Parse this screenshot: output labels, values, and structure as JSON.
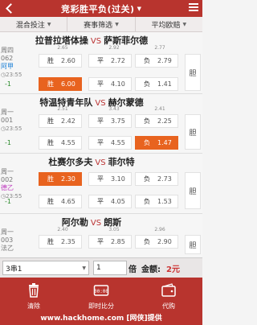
{
  "header": {
    "title": "竞彩胜平负(过关)"
  },
  "tabs": [
    {
      "label": "混合投注"
    },
    {
      "label": "赛事筛选"
    },
    {
      "label": "平均欧赔"
    }
  ],
  "matches": [
    {
      "home": "拉普拉塔体操",
      "away": "萨斯菲尔德",
      "code": "周四062",
      "league": "阿甲",
      "league_color": "#1a7fd6",
      "time": "23:55",
      "handicap": "-1",
      "sp": [
        "2.65",
        "2.92",
        "2.77"
      ],
      "row1": [
        {
          "label": "胜",
          "odd": "2.60"
        },
        {
          "label": "平",
          "odd": "2.72"
        },
        {
          "label": "负",
          "odd": "2.79"
        }
      ],
      "row2": [
        {
          "label": "胜",
          "odd": "6.00"
        },
        {
          "label": "平",
          "odd": "4.10"
        },
        {
          "label": "负",
          "odd": "1.41"
        }
      ],
      "more": "胆"
    },
    {
      "home": "特温特青年队",
      "away": "赫尔蒙德",
      "code": "周一001",
      "league": "",
      "league_color": "#777",
      "time": "23:55",
      "handicap": "-1",
      "sp": [
        "2.51",
        "3.43",
        "2.41"
      ],
      "row1": [
        {
          "label": "胜",
          "odd": "2.42"
        },
        {
          "label": "平",
          "odd": "3.75"
        },
        {
          "label": "负",
          "odd": "2.25"
        }
      ],
      "row2": [
        {
          "label": "胜",
          "odd": "4.55"
        },
        {
          "label": "平",
          "odd": "4.55"
        },
        {
          "label": "负",
          "odd": "1.47"
        }
      ],
      "more": "胆"
    },
    {
      "home": "杜赛尔多夫",
      "away": "菲尔特",
      "code": "周一002",
      "league": "德乙",
      "league_color": "#c040c0",
      "time": "23:55",
      "handicap": "-1",
      "sp": [
        "",
        "",
        ""
      ],
      "row1": [
        {
          "label": "胜",
          "odd": "2.30"
        },
        {
          "label": "平",
          "odd": "3.10"
        },
        {
          "label": "负",
          "odd": "2.73"
        }
      ],
      "row2": [
        {
          "label": "胜",
          "odd": "4.65"
        },
        {
          "label": "平",
          "odd": "4.05"
        },
        {
          "label": "负",
          "odd": "1.53"
        }
      ],
      "more": "胆"
    },
    {
      "home": "阿尔勒",
      "away": "朗斯",
      "code": "周一003",
      "league": "法乙",
      "league_color": "#777",
      "time": "",
      "handicap": "",
      "sp": [
        "2.40",
        "3.05",
        "2.96"
      ],
      "row1": [
        {
          "label": "胜",
          "odd": "2.35"
        },
        {
          "label": "平",
          "odd": "2.85"
        },
        {
          "label": "负",
          "odd": "2.90"
        }
      ],
      "row2": [],
      "more": "胆"
    }
  ],
  "bet": {
    "pass_type": "3串1",
    "multiple": "1",
    "multiple_unit": "倍",
    "amount_label": "金额:",
    "amount": "2元"
  },
  "bottom_nav": [
    {
      "label": "清除"
    },
    {
      "label": "即时比分"
    },
    {
      "label": "代购"
    }
  ],
  "watermark": "www.hackhome.com [网侠]提供",
  "colors": {
    "primary": "#b8342e",
    "selected": "#e8631f"
  }
}
